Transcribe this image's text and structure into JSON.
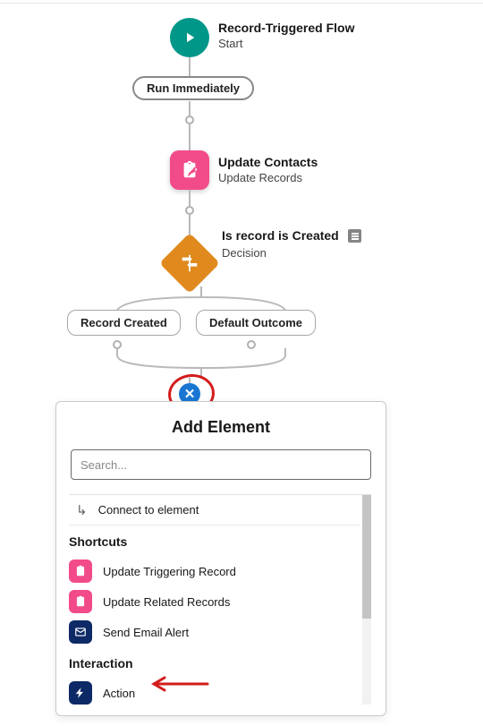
{
  "start": {
    "title": "Record-Triggered Flow",
    "subtitle": "Start"
  },
  "run_immediately": "Run Immediately",
  "update_contacts": {
    "title": "Update Contacts",
    "subtitle": "Update Records"
  },
  "decision": {
    "title": "Is record is Created",
    "subtitle": "Decision"
  },
  "branch_left": "Record Created",
  "branch_right": "Default Outcome",
  "close_glyph": "✕",
  "panel": {
    "title": "Add Element",
    "search_placeholder": "Search...",
    "connect": "Connect to element",
    "section_shortcuts": "Shortcuts",
    "shortcut_update_triggering": "Update Triggering Record",
    "shortcut_update_related": "Update Related Records",
    "shortcut_send_email": "Send Email Alert",
    "section_interaction": "Interaction",
    "action": "Action"
  },
  "colors": {
    "teal": "#009688",
    "pink": "#f24b8a",
    "orange": "#e08a1e",
    "navy": "#0d2a66",
    "blue": "#1976d2",
    "red": "#d31c1c"
  }
}
